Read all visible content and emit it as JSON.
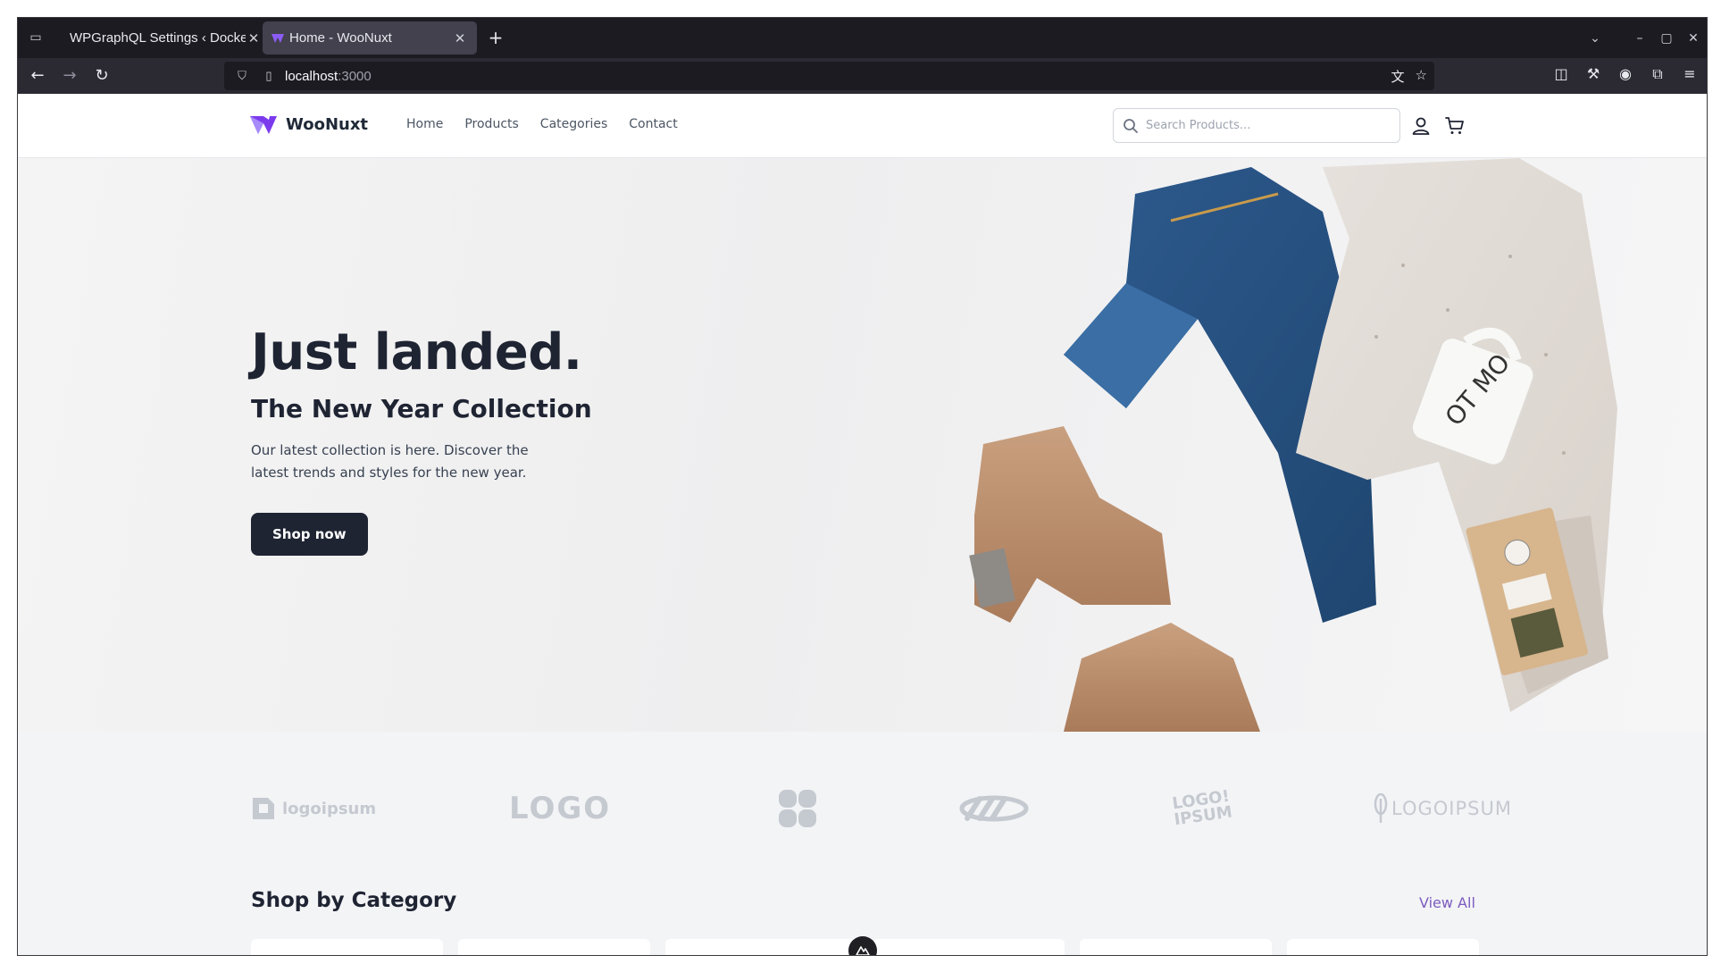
{
  "browser": {
    "tabs": [
      {
        "title": "WPGraphQL Settings ‹ Docke",
        "active": false
      },
      {
        "title": "Home - WooNuxt",
        "active": true
      }
    ],
    "url": {
      "host": "localhost",
      "port": ":3000"
    }
  },
  "site": {
    "brand": "WooNuxt",
    "nav": [
      "Home",
      "Products",
      "Categories",
      "Contact"
    ],
    "search_placeholder": "Search Products..."
  },
  "hero": {
    "headline": "Just landed.",
    "subheadline": "The New Year Collection",
    "description": "Our latest collection is here. Discover the latest trends and styles for the new year.",
    "cta": "Shop now"
  },
  "brands": [
    {
      "name": "logoipsum",
      "icon": "square-logo-icon"
    },
    {
      "name": "LOGO",
      "icon": "logo-wordmark"
    },
    {
      "name": "",
      "icon": "clover-logo-icon"
    },
    {
      "name": "",
      "icon": "infinity-logo-icon"
    },
    {
      "name": "LOGO! IPSUM",
      "icon": "sticker-logo"
    },
    {
      "name": "LOGOIPSUM",
      "icon": "feather-logo-icon"
    }
  ],
  "categories": {
    "title": "Shop by Category",
    "view_all": "View All"
  },
  "colors": {
    "accent": "#7c5cbf",
    "dark": "#1f2433",
    "chrome": "#2b2a33"
  }
}
